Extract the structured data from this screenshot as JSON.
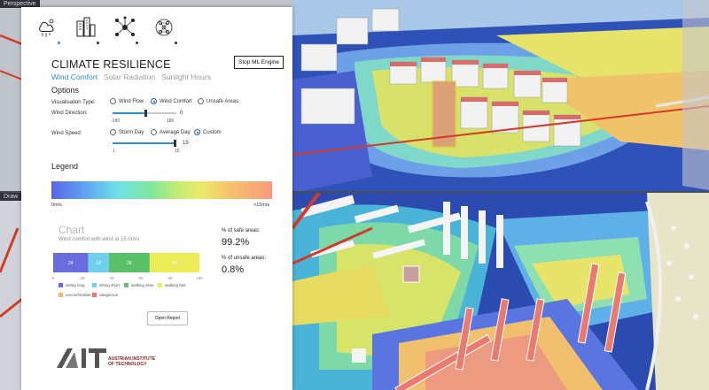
{
  "viewports": {
    "top_label": "Perspective",
    "bottom_label": "Draw"
  },
  "icons": [
    {
      "name": "weather-icon",
      "active": true
    },
    {
      "name": "buildings-icon",
      "active": false
    },
    {
      "name": "network-icon",
      "active": false
    },
    {
      "name": "neural-network-icon",
      "active": false
    }
  ],
  "panel": {
    "title": "CLIMATE RESILIENCE",
    "stop_button": "Stop ML Engine",
    "tabs": [
      {
        "label": "Wind Comfort",
        "active": true
      },
      {
        "label": "Solar Radiation",
        "active": false
      },
      {
        "label": "Sunlight Hours",
        "active": false
      }
    ],
    "options": {
      "heading": "Options",
      "visualisation_label": "Visualisation Type:",
      "visualisation_options": [
        {
          "label": "Wind Flow",
          "checked": false
        },
        {
          "label": "Wind Comfort",
          "checked": true
        },
        {
          "label": "Unsafe Areas",
          "checked": false
        }
      ],
      "direction_label": "Wind Direction:",
      "direction_min": "-180",
      "direction_max": "180",
      "direction_value": "0",
      "direction_fraction": 0.5,
      "speed_label": "Wind Speed:",
      "speed_options": [
        {
          "label": "Storm Day",
          "checked": false
        },
        {
          "label": "Average Day",
          "checked": false
        },
        {
          "label": "Custom",
          "checked": true
        }
      ],
      "speed_min": "1",
      "speed_max": "15",
      "speed_value": "15",
      "speed_fraction": 1.0
    },
    "legend": {
      "heading": "Legend",
      "min_label": "0m/s",
      "max_label": ">15m/s"
    },
    "chart": {
      "title": "Chart",
      "subtitle": "Wind comfort with wind at 15.0m/s",
      "safe_label": "% of safe areas:",
      "safe_value": "99.2%",
      "unsafe_label": "% of unsafe areas:",
      "unsafe_value": "0.8%",
      "keys": [
        {
          "label": "sitting long",
          "color": "#6b6be0"
        },
        {
          "label": "sitting short",
          "color": "#6fd0ee"
        },
        {
          "label": "walking slow",
          "color": "#5ac06a"
        },
        {
          "label": "walking fast",
          "color": "#ecec58"
        },
        {
          "label": "uncomfortable",
          "color": "#f2b86a"
        },
        {
          "label": "dangerous",
          "color": "#ee6f6f"
        }
      ]
    },
    "open_report": "Open Report",
    "logo": {
      "mark": "AIT",
      "line1": "AUSTRIAN INSTITUTE",
      "line2": "OF TECHNOLOGY"
    }
  },
  "chart_data": {
    "type": "bar",
    "orientation": "horizontal-stacked",
    "series": [
      {
        "name": "sitting long",
        "values": [
          24
        ]
      },
      {
        "name": "sitting short",
        "values": [
          14
        ]
      },
      {
        "name": "walking slow",
        "values": [
          28
        ]
      },
      {
        "name": "walking fast",
        "values": [
          34
        ]
      },
      {
        "name": "uncomfortable",
        "values": [
          0
        ]
      },
      {
        "name": "dangerous",
        "values": [
          0
        ]
      }
    ],
    "data_labels": [
      "24",
      "14",
      "28",
      "34"
    ],
    "tick_labels": [
      "0",
      "20",
      "40",
      "60",
      "80",
      "100"
    ],
    "xlim": [
      0,
      100
    ]
  }
}
